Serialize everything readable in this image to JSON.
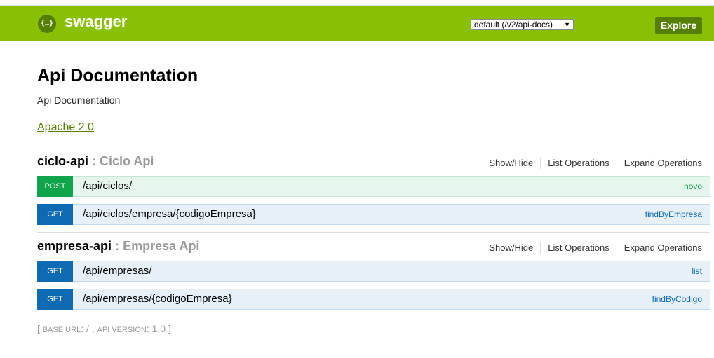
{
  "header": {
    "logo_glyph": "{…}",
    "brand": "swagger",
    "spec_select": {
      "value": "default (/v2/api-docs)",
      "caret": "▼"
    },
    "explore_label": "Explore",
    "background_color": "#89bf04"
  },
  "info": {
    "title": "Api Documentation",
    "description": "Api Documentation",
    "license": "Apache 2.0"
  },
  "resources": [
    {
      "name": "ciclo-api",
      "separator": " : ",
      "description": "Ciclo Api",
      "actions": [
        "Show/Hide",
        "List Operations",
        "Expand Operations"
      ],
      "operations": [
        {
          "method": "POST",
          "path": "/api/ciclos/",
          "nickname": "novo"
        },
        {
          "method": "GET",
          "path": "/api/ciclos/empresa/{codigoEmpresa}",
          "nickname": "findByEmpresa"
        }
      ]
    },
    {
      "name": "empresa-api",
      "separator": " : ",
      "description": "Empresa Api",
      "actions": [
        "Show/Hide",
        "List Operations",
        "Expand Operations"
      ],
      "operations": [
        {
          "method": "GET",
          "path": "/api/empresas/",
          "nickname": "list"
        },
        {
          "method": "GET",
          "path": "/api/empresas/{codigoEmpresa}",
          "nickname": "findByCodigo"
        }
      ]
    }
  ],
  "footer": {
    "open": "[ ",
    "base_url_label": "base url",
    "base_url_sep": ": ",
    "base_url_value": "/",
    "comma": " , ",
    "api_version_label": "api version",
    "api_version_sep": ": ",
    "api_version_value": "1.0",
    "close": " ]"
  },
  "colors": {
    "post": "#10a54a",
    "get": "#0f6ab4",
    "accent": "#547f00"
  }
}
